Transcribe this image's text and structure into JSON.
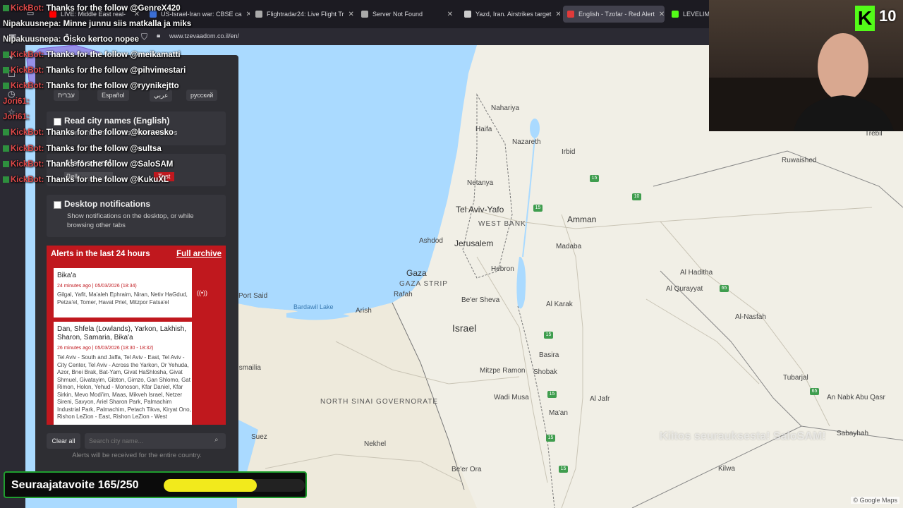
{
  "browser": {
    "tabs": [
      {
        "label": "LIVE: Middle East real-",
        "fav": "#ff0000"
      },
      {
        "label": "US-Israel-Iran war: CBSE ca",
        "fav": "#3b6fd6"
      },
      {
        "label": "Flightradar24: Live Flight Tr",
        "fav": "#aaaaaa"
      },
      {
        "label": "Server Not Found",
        "fav": "#aaaaaa"
      },
      {
        "label": "Yazd, Iran. Airstrikes target",
        "fav": "#cccccc"
      },
      {
        "label": "English - Tzofar - Red Alert",
        "fav": "#e03a3a"
      },
      {
        "label": "LEVELIMEI",
        "fav": "#53fc18"
      }
    ],
    "url": "www.tzevaadom.co.il/en/"
  },
  "panel": {
    "languages": [
      "עברית",
      "Español",
      "عربي",
      "русский"
    ],
    "read_city_names": {
      "label": "Read city names (English)",
      "desc": "Announce the names of alerted cities"
    },
    "alert_sound": {
      "label": "Alert sound",
      "select": "Bell",
      "test": "Test"
    },
    "desktop_notifications": {
      "label": "Desktop notifications",
      "desc": "Show notifications on the desktop, or while browsing other tabs"
    },
    "alerts_header": "Alerts in the last 24 hours",
    "full_archive": "Full archive",
    "alerts": [
      {
        "city": "Bika'a",
        "time": "24 minutes ago | 05/03/2026 (18:34)",
        "areas": "Gilgal, Yafit, Ma'aleh Ephraim, Niran, Netiv HaGdud, Petza'el, Tomer, Havat Priel, Mitzpor Fatsa'el"
      },
      {
        "city": "Dan, Shfela (Lowlands), Yarkon, Lakhish, Sharon, Samaria, Bika'a",
        "time": "26 minutes ago | 05/03/2026 (18:30 - 18:32)",
        "areas": "Tel Aviv - South and Jaffa, Tel Aviv - East, Tel Aviv - City Center, Tel Aviv - Across the Yarkon, Or Yehuda, Azor, Bnei Brak, Bat-Yam, Givat HaShlosha, Givat Shmuel, Givatayim, Gibton, Gimzo, Gan Shlomo, Gat Rimon, Holon, Yehud - Monoson, Kfar Daniel, Kfar Sirkin, Mevo Modi'im, Maas, Mikveh Israel, Netzer Sireni, Savyon, Ariel Sharon Park, Palmachim Industrial Park, Palmachim, Petach Tikva, Kiryat Ono, Rishon LeZion - East, Rishon LeZion - West"
      }
    ],
    "clear_all": "Clear all",
    "search_placeholder": "Search city name...",
    "footer": "Alerts will be received for the entire country."
  },
  "chat": [
    {
      "user": "KickBot:",
      "text": "Thanks for the follow @GenreX420",
      "bot": true
    },
    {
      "user": "Nipakuusnepa:",
      "text": "Minne junnu siis matkalla ja miks",
      "bot": false
    },
    {
      "user": "Nipakuusnepa:",
      "text": "Oisko kertoo nopee",
      "bot": false
    },
    {
      "user": "KickBot:",
      "text": "Thanks for the follow @meikamatti",
      "bot": true
    },
    {
      "user": "KickBot:",
      "text": "Thanks for the follow @pihvimestari",
      "bot": true
    },
    {
      "user": "KickBot:",
      "text": "Thanks for the follow @ryynikejtto",
      "bot": true
    },
    {
      "user": "Jori61:",
      "text": "",
      "bot": false
    },
    {
      "user": "Jori61:",
      "text": "",
      "bot": false
    },
    {
      "user": "KickBot:",
      "text": "Thanks for the follow @koraesko",
      "bot": true
    },
    {
      "user": "KickBot:",
      "text": "Thanks for the follow @sultsa",
      "bot": true
    },
    {
      "user": "KickBot:",
      "text": "Thanks for the follow @SaloSAM",
      "bot": true
    },
    {
      "user": "KickBot:",
      "text": "Thanks for the follow @KukuXL",
      "bot": true
    }
  ],
  "stream": {
    "viewer_count": "10",
    "goal_text": "Seuraajatavoite 165/250",
    "goal_current": 165,
    "goal_target": 250,
    "follow_thanks": "Kiitos seurauksesta! SaloSAM!"
  },
  "map": {
    "labels": [
      {
        "t": "Haifa",
        "c": "ml"
      },
      {
        "t": "Netanya",
        "c": "ml"
      },
      {
        "t": "Tel Aviv-Yafo",
        "c": "ml big"
      },
      {
        "t": "Ashdod",
        "c": "ml"
      },
      {
        "t": "Jerusalem",
        "c": "ml big"
      },
      {
        "t": "Gaza",
        "c": "ml big"
      },
      {
        "t": "GAZA STRIP",
        "c": "ml region"
      },
      {
        "t": "WEST BANK",
        "c": "ml region"
      },
      {
        "t": "Amman",
        "c": "ml big"
      },
      {
        "t": "Hebron",
        "c": "ml"
      },
      {
        "t": "Be'er Sheva",
        "c": "ml"
      },
      {
        "t": "Israel",
        "c": "ml big"
      },
      {
        "t": "Rafah",
        "c": "ml"
      },
      {
        "t": "Irbid",
        "c": "ml"
      },
      {
        "t": "Madaba",
        "c": "ml"
      },
      {
        "t": "Al Karak",
        "c": "ml"
      },
      {
        "t": "Ruwaished",
        "c": "ml"
      },
      {
        "t": "Al Haditha",
        "c": "ml"
      },
      {
        "t": "Al Qurayyat",
        "c": "ml"
      },
      {
        "t": "Al-Nasfah",
        "c": "ml"
      },
      {
        "t": "Tubarjal",
        "c": "ml"
      },
      {
        "t": "An Nabk Abu Qasr",
        "c": "ml"
      },
      {
        "t": "Sabayhah",
        "c": "ml"
      },
      {
        "t": "Kilwa",
        "c": "ml"
      },
      {
        "t": "NORTH SINAI GOVERNORATE",
        "c": "ml region"
      },
      {
        "t": "Suez",
        "c": "ml"
      },
      {
        "t": "Nekhel",
        "c": "ml"
      },
      {
        "t": "Be'er Ora",
        "c": "ml"
      },
      {
        "t": "Shobak",
        "c": "ml"
      },
      {
        "t": "Basira",
        "c": "ml"
      },
      {
        "t": "Mitzpe Ramon",
        "c": "ml"
      },
      {
        "t": "Wadi Musa",
        "c": "ml"
      },
      {
        "t": "Ma'an",
        "c": "ml"
      },
      {
        "t": "Al Jafr",
        "c": "ml"
      },
      {
        "t": "Bardawil Lake",
        "c": "ml water"
      },
      {
        "t": "Port Said",
        "c": "ml"
      },
      {
        "t": "Arish",
        "c": "ml"
      },
      {
        "t": "Nazareth",
        "c": "ml"
      },
      {
        "t": "Nahariya",
        "c": "ml"
      },
      {
        "t": "Trebil",
        "c": "ml"
      },
      {
        "t": "Ismailia",
        "c": "ml"
      }
    ],
    "credit": "© Google Maps"
  }
}
